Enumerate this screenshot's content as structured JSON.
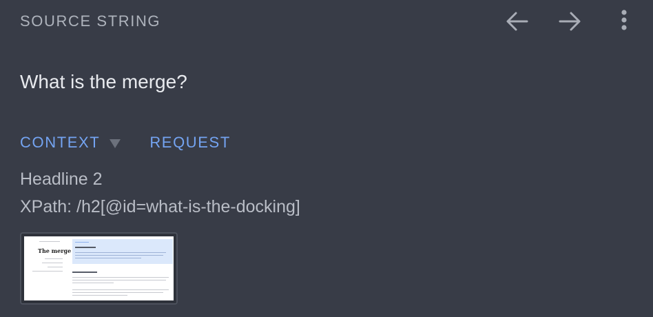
{
  "header": {
    "title": "SOURCE STRING",
    "back_icon": "arrow-left-icon",
    "forward_icon": "arrow-right-icon",
    "menu_icon": "more-vert-icon"
  },
  "source": {
    "text": "What is the merge?"
  },
  "tabs": [
    {
      "label": "CONTEXT",
      "dropdown": true
    },
    {
      "label": "REQUEST"
    }
  ],
  "context": {
    "element_type": "Headline 2",
    "xpath": "XPath: /h2[@id=what-is-the-docking]"
  },
  "screenshot_thumbnail": {
    "page_title": "The merge"
  },
  "colors": {
    "background": "#383c47",
    "accent": "#74a4f2",
    "muted_text": "#aeb3bc"
  }
}
